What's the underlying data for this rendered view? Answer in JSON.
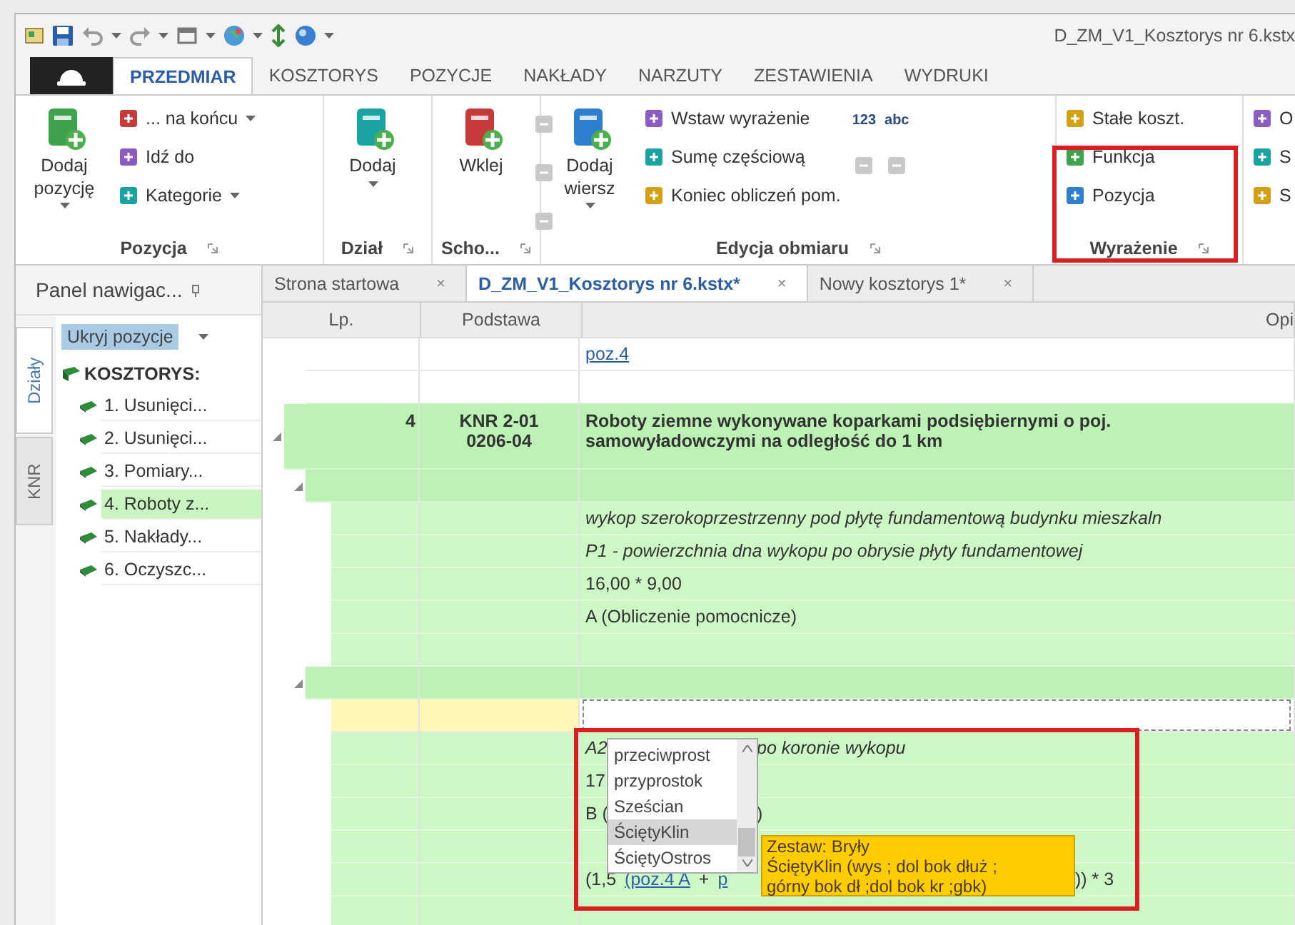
{
  "title_bar": {
    "title": "D_ZM_V1_Kosztorys nr 6.kstx"
  },
  "ribbon_tabs": [
    {
      "label": "PRZEDMIAR",
      "selected": true
    },
    {
      "label": "KOSZTORYS",
      "selected": false
    },
    {
      "label": "POZYCJE",
      "selected": false
    },
    {
      "label": "NAKŁADY",
      "selected": false
    },
    {
      "label": "NARZUTY",
      "selected": false
    },
    {
      "label": "ZESTAWIENIA",
      "selected": false
    },
    {
      "label": "WYDRUKI",
      "selected": false
    }
  ],
  "ribbon_groups": [
    {
      "label": "Pozycja",
      "columns": [
        [
          {
            "kind": "large",
            "label": "Dodaj pozycję",
            "dropdown": true
          }
        ],
        [
          {
            "kind": "small",
            "label": "... na końcu",
            "dropdown": true
          },
          {
            "kind": "small",
            "label": "Idź do",
            "dropdown": false
          },
          {
            "kind": "small",
            "label": "Kategorie",
            "dropdown": true
          }
        ]
      ]
    },
    {
      "label": "Dział",
      "columns": [
        [
          {
            "kind": "large",
            "label": "Dodaj",
            "dropdown": true
          }
        ]
      ]
    },
    {
      "label": "Scho...",
      "columns": [
        [
          {
            "kind": "large",
            "label": "Wklej",
            "dropdown": false
          }
        ],
        [
          {
            "kind": "icon",
            "disabled": true
          },
          {
            "kind": "icon",
            "disabled": true
          },
          {
            "kind": "icon",
            "disabled": true
          }
        ]
      ]
    },
    {
      "label": "Edycja obmiaru",
      "columns": [
        [
          {
            "kind": "large",
            "label": "Dodaj wiersz",
            "dropdown": true
          }
        ],
        [
          {
            "kind": "small",
            "label": "Wstaw wyrażenie",
            "dropdown": false
          },
          {
            "kind": "small",
            "label": "Sumę częściową",
            "dropdown": false
          },
          {
            "kind": "small",
            "label": "Koniec obliczeń pom.",
            "dropdown": false
          }
        ],
        [
          {
            "kind": "label",
            "label": "123"
          },
          {
            "kind": "icon",
            "disabled": true
          }
        ],
        [
          {
            "kind": "label",
            "label": "abc"
          },
          {
            "kind": "icon",
            "disabled": true
          }
        ]
      ]
    },
    {
      "label": "Wyrażenie",
      "columns": [
        [
          {
            "kind": "small",
            "label": "Stałe koszt.",
            "dropdown": false
          },
          {
            "kind": "small",
            "label": "Funkcja",
            "dropdown": false
          },
          {
            "kind": "small",
            "label": "Pozycja",
            "dropdown": false
          }
        ]
      ]
    },
    {
      "columns": [
        [
          {
            "kind": "small",
            "label": "O"
          },
          {
            "kind": "small",
            "label": "S"
          },
          {
            "kind": "small",
            "label": "S"
          }
        ]
      ]
    }
  ],
  "nav_panel": {
    "title": "Panel nawigac...",
    "side_tabs": [
      {
        "label": "Działy",
        "selected": true
      },
      {
        "label": "KNR",
        "selected": false
      }
    ],
    "filter": {
      "value": "Ukryj pozycje"
    },
    "tree": {
      "label": "KOSZTORYS:",
      "children": [
        {
          "label": "1. Usunięci...",
          "selected": false
        },
        {
          "label": "2. Usunięci...",
          "selected": false
        },
        {
          "label": "3. Pomiary...",
          "selected": false
        },
        {
          "label": "4. Roboty z...",
          "selected": true
        },
        {
          "label": "5. Nakłady...",
          "selected": false
        },
        {
          "label": "6. Oczyszc...",
          "selected": false
        }
      ]
    }
  },
  "doc_tabs": [
    {
      "label": "Strona startowa",
      "close": "×",
      "selected": false
    },
    {
      "label": "D_ZM_V1_Kosztorys nr 6.kstx*",
      "close": "×",
      "selected": true
    },
    {
      "label": "Nowy kosztorys 1*",
      "close": "×",
      "selected": false
    }
  ],
  "grid": {
    "columns": [
      "Lp.",
      "Podstawa",
      "Opi"
    ],
    "rows": [
      {
        "kind": "link",
        "opis": "poz.4"
      },
      {
        "kind": "blank"
      },
      {
        "kind": "position",
        "lp": "4",
        "podstawa": "KNR 2-01 0206-04",
        "opis_lines": [
          "Roboty ziemne wykonywane koparkami podsiębiernymi o poj.",
          "samowyładowczymi na odległość do 1 km"
        ],
        "expanded": true,
        "children": [
          {
            "kind": "group",
            "expanded": true,
            "children": [
              {
                "kind": "italic",
                "opis": "wykop szerokoprzestrzenny pod płytę fundamentową budynku mieszkaln"
              },
              {
                "kind": "italic",
                "opis": "P1 - powierzchnia dna wykopu po obrysie płyty fundamentowej"
              },
              {
                "kind": "plain",
                "opis": "16,00 * 9,00"
              },
              {
                "kind": "plain",
                "opis": "A (Obliczenie pomocnicze)"
              },
              {
                "kind": "blank"
              }
            ]
          },
          {
            "kind": "group",
            "expanded": true,
            "children": [
              {
                "kind": "edit"
              },
              {
                "kind": "parts",
                "parts": [
                  {
                    "text": "A2",
                    "kind": "italic"
                  },
                  {
                    "text": "po koronie wykopu",
                    "kind": "italic-past-list"
                  }
                ]
              },
              {
                "kind": "parts",
                "parts": [
                  {
                    "text": "17",
                    "kind": "plain"
                  }
                ]
              },
              {
                "kind": "parts",
                "parts": [
                  {
                    "text": "B (",
                    "kind": "plain"
                  },
                  {
                    "text": ")",
                    "kind": "plain-past-list"
                  }
                ]
              },
              {
                "kind": "blank"
              },
              {
                "kind": "parts",
                "parts": [
                  {
                    "text": "(1,5",
                    "kind": "plain"
                  },
                  {
                    "text": "(poz.4 A",
                    "kind": "link"
                  },
                  {
                    "text": "+",
                    "kind": "plain"
                  },
                  {
                    "text": "p",
                    "kind": "link"
                  },
                  {
                    "text": ")) * 3",
                    "kind": "plain-past-tooltip"
                  }
                ]
              },
              {
                "kind": "blank"
              }
            ]
          }
        ]
      }
    ]
  },
  "autocomplete": {
    "items": [
      {
        "label": "przeciwprost",
        "selected": false
      },
      {
        "label": "przyprostok",
        "selected": false
      },
      {
        "label": "Sześcian",
        "selected": false
      },
      {
        "label": "ŚciętyKlin",
        "selected": true
      },
      {
        "label": "ŚciętyOstros",
        "selected": false
      }
    ]
  },
  "tooltip": {
    "lines": [
      "Zestaw: Bryły",
      "ŚciętyKlin (wys ; dol bok dłuż ;",
      "górny bok dł ;dol bok kr ;gbk)"
    ]
  }
}
